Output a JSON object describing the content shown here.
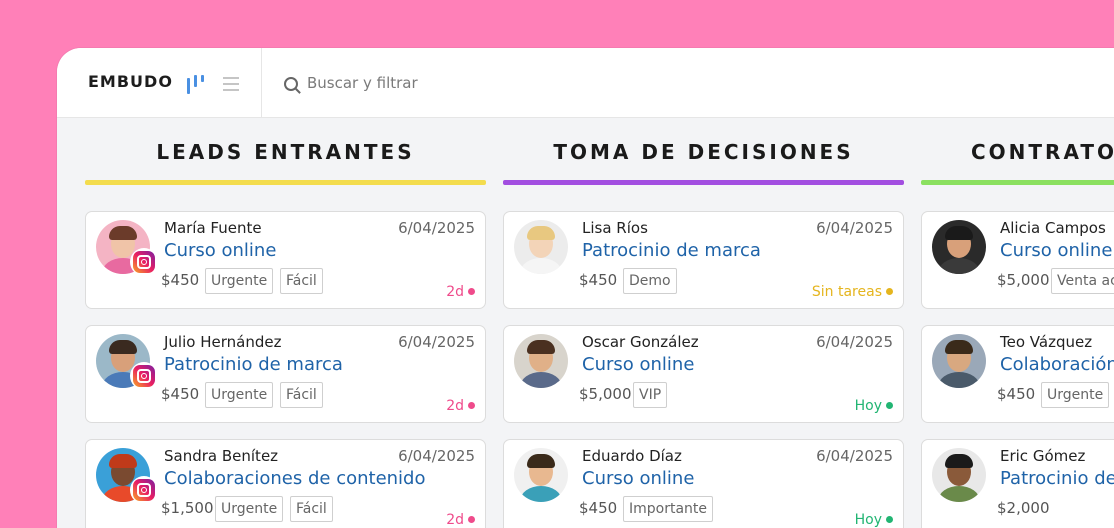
{
  "header": {
    "title": "EMBUDO",
    "search_placeholder": "Buscar y filtrar"
  },
  "colors": {
    "background": "#ff80b8",
    "link_blue": "#1f63a8",
    "kanban_icon": "#4a90e2"
  },
  "columns": [
    {
      "title": "LEADS ENTRANTES",
      "bar_color": "#f3dc4e",
      "cards": [
        {
          "name": "María Fuente",
          "date": "6/04/2025",
          "course": "Curso online",
          "price": "$450",
          "tags": [
            "Urgente",
            "Fácil"
          ],
          "status": "2d",
          "status_color": "#ef4b8b",
          "instagram": true
        },
        {
          "name": "Julio Hernández",
          "date": "6/04/2025",
          "course": "Patrocinio de marca",
          "price": "$450",
          "tags": [
            "Urgente",
            "Fácil"
          ],
          "status": "2d",
          "status_color": "#ef4b8b",
          "instagram": true
        },
        {
          "name": "Sandra Benítez",
          "date": "6/04/2025",
          "course": "Colaboraciones de contenido",
          "price": "$1,500",
          "tags": [
            "Urgente",
            "Fácil"
          ],
          "status": "2d",
          "status_color": "#ef4b8b",
          "instagram": true
        }
      ]
    },
    {
      "title": "TOMA DE DECISIONES",
      "bar_color": "#a24ee0",
      "cards": [
        {
          "name": "Lisa Ríos",
          "date": "6/04/2025",
          "course": "Patrocinio de marca",
          "price": "$450",
          "tags": [
            "Demo"
          ],
          "status": "Sin tareas",
          "status_color": "#e5b51e",
          "instagram": false
        },
        {
          "name": "Oscar González",
          "date": "6/04/2025",
          "course": "Curso online",
          "price": "$5,000",
          "tags": [
            "VIP"
          ],
          "status": "Hoy",
          "status_color": "#22b573",
          "instagram": false
        },
        {
          "name": "Eduardo Díaz",
          "date": "6/04/2025",
          "course": "Curso online",
          "price": "$450",
          "tags": [
            "Importante"
          ],
          "status": "Hoy",
          "status_color": "#22b573",
          "instagram": false
        }
      ]
    },
    {
      "title": "CONTRATOS",
      "bar_color": "#8be060",
      "cards": [
        {
          "name": "Alicia Campos",
          "date": "",
          "course": "Curso online",
          "price": "$5,000",
          "tags": [
            "Venta ac"
          ],
          "status": "",
          "status_color": "",
          "instagram": false
        },
        {
          "name": "Teo Vázquez",
          "date": "",
          "course": "Colaboración c",
          "price": "$450",
          "tags": [
            "Urgente"
          ],
          "status": "",
          "status_color": "",
          "instagram": false
        },
        {
          "name": "Eric Gómez",
          "date": "",
          "course": "Patrocinio de r",
          "price": "$2,000",
          "tags": [],
          "status": "",
          "status_color": "",
          "instagram": false
        }
      ]
    }
  ]
}
